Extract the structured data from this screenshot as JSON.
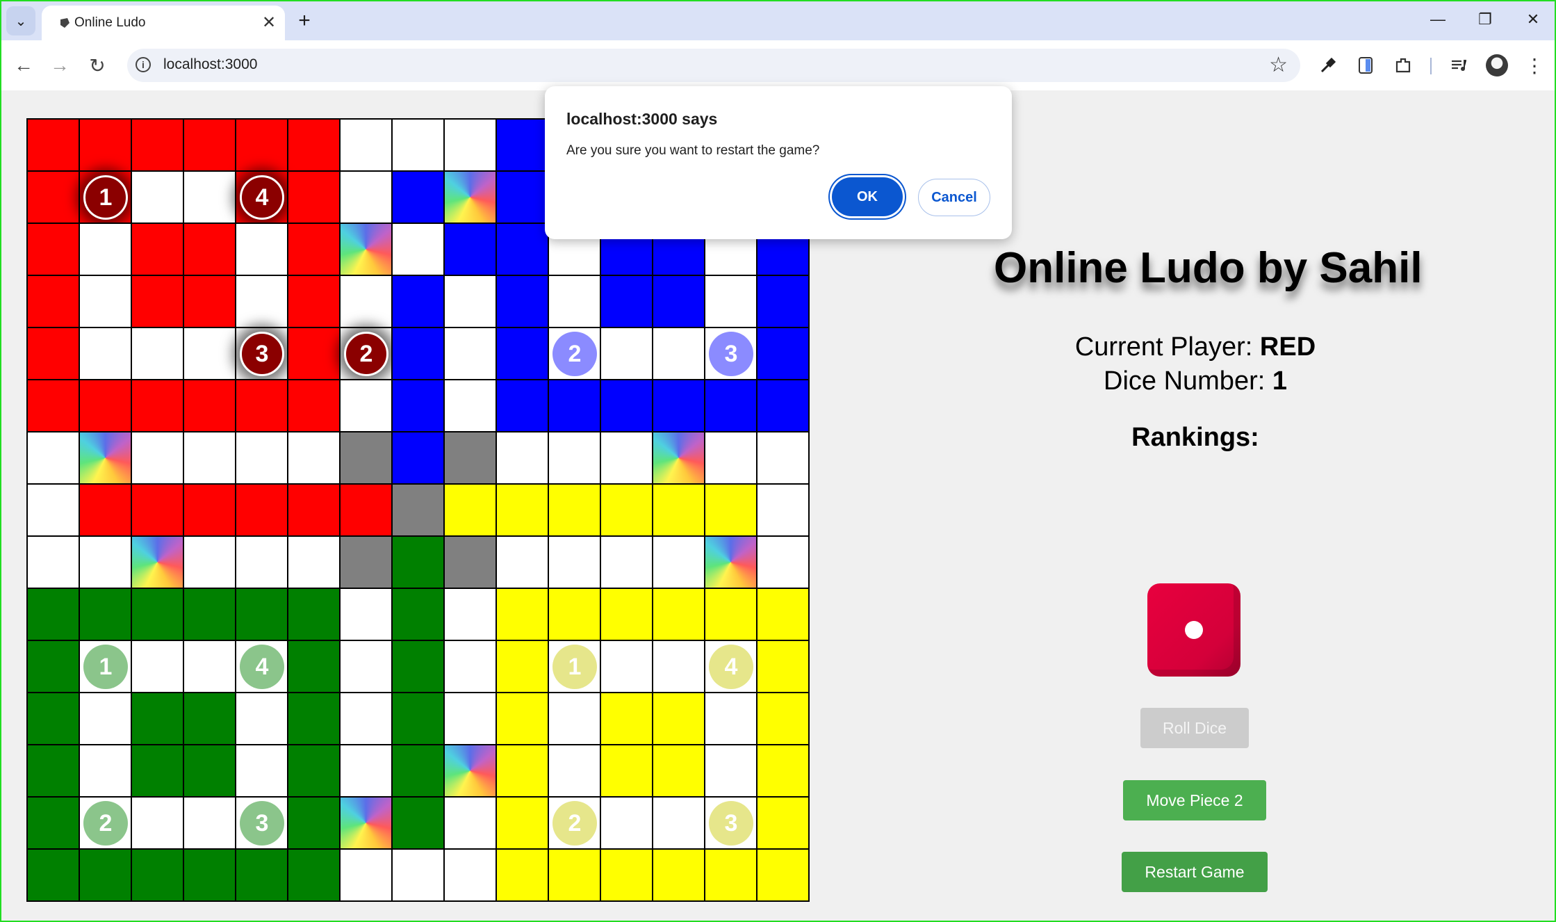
{
  "browser": {
    "tab_title": "Online Ludo",
    "tab_close_glyph": "✕",
    "new_tab_glyph": "+",
    "tab_search_glyph": "⌄",
    "url": "localhost:3000",
    "window_controls": {
      "minimize": "—",
      "restore": "❐",
      "close": "✕"
    },
    "nav": {
      "back": "←",
      "forward": "→",
      "reload": "↻"
    },
    "icons": [
      "tab-search-icon",
      "globe-icon",
      "close-icon",
      "back-icon",
      "forward-icon",
      "reload-icon",
      "site-info-icon",
      "star-icon",
      "eyedropper-icon",
      "sidepanel-icon",
      "extensions-icon",
      "media-control-icon",
      "profile-avatar",
      "kebab-menu-icon"
    ]
  },
  "game": {
    "title": "Online Ludo by Sahil",
    "current_player_label": "Current Player: ",
    "current_player": "RED",
    "dice_label": "Dice Number: ",
    "dice_number": "1",
    "rankings_label": "Rankings:",
    "buttons": {
      "roll": "Roll Dice",
      "move": "Move Piece 2",
      "restart": "Restart Game"
    },
    "roll_disabled": true
  },
  "dialog": {
    "title": "localhost:3000 says",
    "message": "Are you sure you want to restart the game?",
    "ok": "OK",
    "cancel": "Cancel"
  },
  "colors": {
    "red": "#ff0000",
    "blue": "#0000ff",
    "green": "#008000",
    "yellow": "#ffff00",
    "gray": "#808080",
    "active_piece": "#8b0000",
    "blue_piece": "#8080bf",
    "green_piece": "#80bf80",
    "yellow_piece": "#dede80",
    "dialog_accent": "#0b57d0",
    "button_green": "#4caf50"
  },
  "board": {
    "rows": [
      "rrrrrrwwwbbbbbb",
      "rrwwrrwbsbbwwbb",
      "rwrrwrswbbwbbwb",
      "rwrrwrwbwbwbbwb",
      "rwwwwrwbwbwwwwb",
      "rrrrrrwbwbbbbbb",
      "wswwwwxbxwwwsww",
      "wrrrrrrxyyyyyyw",
      "wwswwwxgxwwwwsw",
      "ggggggwgwyyyyyy",
      "gwwwwgwgwywwwwy",
      "gwggwgwgwywyywy",
      "gwggwgwgsywyywy",
      "gwwwwgsgwywwwwy",
      "ggggggwwwyyyyyy"
    ],
    "pieces": [
      {
        "color": "red",
        "label": "1",
        "row": 1,
        "col": 1,
        "active": true
      },
      {
        "color": "red",
        "label": "4",
        "row": 1,
        "col": 4,
        "active": true
      },
      {
        "color": "red",
        "label": "3",
        "row": 4,
        "col": 4,
        "active": true
      },
      {
        "color": "red",
        "label": "2",
        "row": 4,
        "col": 6,
        "active": true
      },
      {
        "color": "blue",
        "label": "2",
        "row": 4,
        "col": 10,
        "active": false
      },
      {
        "color": "blue",
        "label": "3",
        "row": 4,
        "col": 13,
        "active": false
      },
      {
        "color": "green",
        "label": "1",
        "row": 10,
        "col": 1,
        "active": false
      },
      {
        "color": "green",
        "label": "4",
        "row": 10,
        "col": 4,
        "active": false
      },
      {
        "color": "green",
        "label": "2",
        "row": 13,
        "col": 1,
        "active": false
      },
      {
        "color": "green",
        "label": "3",
        "row": 13,
        "col": 4,
        "active": false
      },
      {
        "color": "yellow",
        "label": "1",
        "row": 10,
        "col": 10,
        "active": false
      },
      {
        "color": "yellow",
        "label": "4",
        "row": 10,
        "col": 13,
        "active": false
      },
      {
        "color": "yellow",
        "label": "2",
        "row": 13,
        "col": 10,
        "active": false
      },
      {
        "color": "yellow",
        "label": "3",
        "row": 13,
        "col": 13,
        "active": false
      }
    ]
  }
}
